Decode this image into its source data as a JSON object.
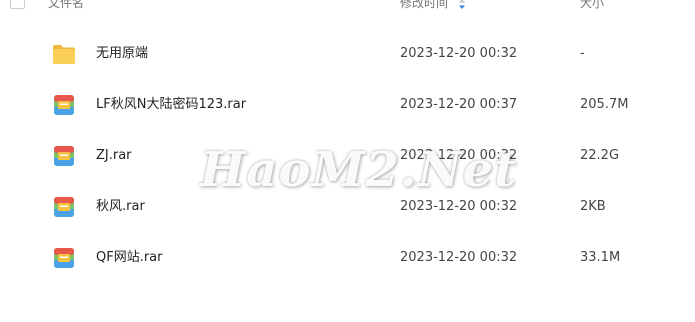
{
  "header": {
    "name": "文件名",
    "modified": "修改时间",
    "size": "大小"
  },
  "files": [
    {
      "icon": "folder-icon",
      "name": "无用原端",
      "modified": "2023-12-20 00:32",
      "size": "-"
    },
    {
      "icon": "archive-icon",
      "name": "LF秋风N大陆密码123.rar",
      "modified": "2023-12-20 00:37",
      "size": "205.7M"
    },
    {
      "icon": "archive-icon",
      "name": "ZJ.rar",
      "modified": "2023-12-20 00:32",
      "size": "22.2G"
    },
    {
      "icon": "archive-icon",
      "name": "秋风.rar",
      "modified": "2023-12-20 00:32",
      "size": "2KB"
    },
    {
      "icon": "archive-icon",
      "name": "QF网站.rar",
      "modified": "2023-12-20 00:32",
      "size": "33.1M"
    }
  ],
  "watermark": "HaoM2.Net",
  "colors": {
    "folder": "#f7c548",
    "archive_red": "#e8584a",
    "archive_green": "#7cc36a",
    "archive_blue": "#4aa3e8",
    "archive_yellow": "#f5c242",
    "sort_active": "#3b82f6"
  }
}
